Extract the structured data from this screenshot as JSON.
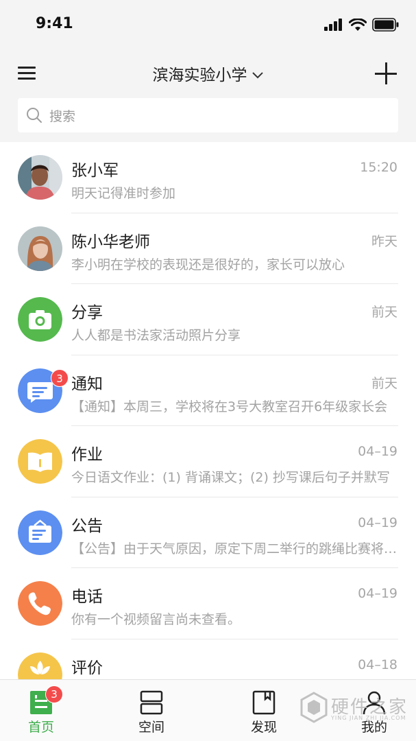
{
  "status_bar": {
    "time": "9:41"
  },
  "nav": {
    "title": "滨海实验小学"
  },
  "search": {
    "placeholder": "搜索"
  },
  "chats": [
    {
      "name": "张小军",
      "time": "15:20",
      "preview": "明天记得准时参加",
      "avatar": "photo-man"
    },
    {
      "name": "陈小华老师",
      "time": "昨天",
      "preview": "李小明在学校的表现还是很好的，家长可以放心",
      "avatar": "photo-woman"
    },
    {
      "name": "分享",
      "time": "前天",
      "preview": "人人都是书法家活动照片分享",
      "avatar": "camera-icon",
      "color": "#55b94e"
    },
    {
      "name": "通知",
      "time": "前天",
      "preview": "【通知】本周三，学校将在3号大教室召开6年级家长会",
      "avatar": "message-icon",
      "color": "#5c8ff0",
      "badge": "3"
    },
    {
      "name": "作业",
      "time": "04–19",
      "preview": "今日语文作业：(1) 背诵课文；(2) 抄写课后句子并默写",
      "avatar": "book-icon",
      "color": "#f5c54a"
    },
    {
      "name": "公告",
      "time": "04–19",
      "preview": "【公告】由于天气原因，原定下周二举行的跳绳比赛将延期",
      "avatar": "announcement-icon",
      "color": "#5c8ff0"
    },
    {
      "name": "电话",
      "time": "04–19",
      "preview": "你有一个视频留言尚未查看。",
      "avatar": "phone-icon",
      "color": "#f5804a"
    },
    {
      "name": "评价",
      "time": "04–18",
      "preview": "",
      "avatar": "flower-icon",
      "color": "#f5c54a"
    }
  ],
  "tabs": [
    {
      "label": "首页",
      "icon": "home-icon",
      "badge": "3",
      "active": true
    },
    {
      "label": "空间",
      "icon": "space-icon"
    },
    {
      "label": "发现",
      "icon": "discover-icon"
    },
    {
      "label": "我的",
      "icon": "profile-icon"
    }
  ],
  "watermark": {
    "main": "硬件之家",
    "sub": "YING JIAN ZHI JIA.COM"
  },
  "colors": {
    "accent": "#3fae4c",
    "badge": "#f34b4b"
  }
}
